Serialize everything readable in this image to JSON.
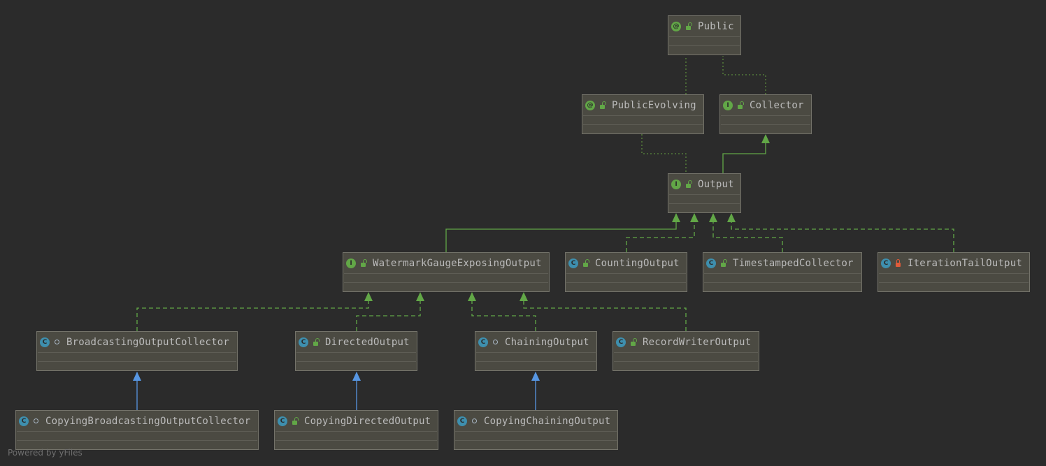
{
  "colors": {
    "background": "#2b2b2b",
    "node_fill": "#4b4a42",
    "interface_edge": "#62a747",
    "class_extends_edge": "#5796e2",
    "annotation_edge": "#62a747"
  },
  "nodes": [
    {
      "id": "Public",
      "label": "Public",
      "kind": "annotation",
      "kind_icon": "annotation-icon",
      "visibility": "public"
    },
    {
      "id": "PublicEvolving",
      "label": "PublicEvolving",
      "kind": "annotation",
      "kind_icon": "annotation-icon",
      "visibility": "public"
    },
    {
      "id": "Collector",
      "label": "Collector",
      "kind": "interface",
      "kind_icon": "interface-icon",
      "visibility": "public"
    },
    {
      "id": "Output",
      "label": "Output",
      "kind": "interface",
      "kind_icon": "interface-icon",
      "visibility": "public"
    },
    {
      "id": "WatermarkGaugeExposingOutput",
      "label": "WatermarkGaugeExposingOutput",
      "kind": "interface",
      "kind_icon": "interface-icon",
      "visibility": "public"
    },
    {
      "id": "CountingOutput",
      "label": "CountingOutput",
      "kind": "class",
      "kind_icon": "class-icon",
      "visibility": "public"
    },
    {
      "id": "TimestampedCollector",
      "label": "TimestampedCollector",
      "kind": "class",
      "kind_icon": "class-icon",
      "visibility": "public"
    },
    {
      "id": "IterationTailOutput",
      "label": "IterationTailOutput",
      "kind": "class",
      "kind_icon": "class-icon",
      "visibility": "private"
    },
    {
      "id": "BroadcastingOutputCollector",
      "label": "BroadcastingOutputCollector",
      "kind": "class",
      "kind_icon": "class-icon",
      "visibility": "package"
    },
    {
      "id": "DirectedOutput",
      "label": "DirectedOutput",
      "kind": "class",
      "kind_icon": "class-icon",
      "visibility": "public"
    },
    {
      "id": "ChainingOutput",
      "label": "ChainingOutput",
      "kind": "class",
      "kind_icon": "class-icon",
      "visibility": "package"
    },
    {
      "id": "RecordWriterOutput",
      "label": "RecordWriterOutput",
      "kind": "class",
      "kind_icon": "class-icon",
      "visibility": "public"
    },
    {
      "id": "CopyingBroadcastingOutputCollector",
      "label": "CopyingBroadcastingOutputCollector",
      "kind": "class",
      "kind_icon": "class-icon",
      "visibility": "package"
    },
    {
      "id": "CopyingDirectedOutput",
      "label": "CopyingDirectedOutput",
      "kind": "class",
      "kind_icon": "class-icon",
      "visibility": "public"
    },
    {
      "id": "CopyingChainingOutput",
      "label": "CopyingChainingOutput",
      "kind": "class",
      "kind_icon": "class-icon",
      "visibility": "package"
    }
  ],
  "edges": [
    {
      "from": "PublicEvolving",
      "to": "Public",
      "type": "annotated-by"
    },
    {
      "from": "Collector",
      "to": "Public",
      "type": "annotated-by"
    },
    {
      "from": "Output",
      "to": "PublicEvolving",
      "type": "annotated-by"
    },
    {
      "from": "Output",
      "to": "Collector",
      "type": "extends-interface"
    },
    {
      "from": "WatermarkGaugeExposingOutput",
      "to": "Output",
      "type": "extends-interface"
    },
    {
      "from": "CountingOutput",
      "to": "Output",
      "type": "implements"
    },
    {
      "from": "TimestampedCollector",
      "to": "Output",
      "type": "implements"
    },
    {
      "from": "IterationTailOutput",
      "to": "Output",
      "type": "implements"
    },
    {
      "from": "BroadcastingOutputCollector",
      "to": "WatermarkGaugeExposingOutput",
      "type": "implements"
    },
    {
      "from": "DirectedOutput",
      "to": "WatermarkGaugeExposingOutput",
      "type": "implements"
    },
    {
      "from": "ChainingOutput",
      "to": "WatermarkGaugeExposingOutput",
      "type": "implements"
    },
    {
      "from": "RecordWriterOutput",
      "to": "WatermarkGaugeExposingOutput",
      "type": "implements"
    },
    {
      "from": "CopyingBroadcastingOutputCollector",
      "to": "BroadcastingOutputCollector",
      "type": "extends"
    },
    {
      "from": "CopyingDirectedOutput",
      "to": "DirectedOutput",
      "type": "extends"
    },
    {
      "from": "CopyingChainingOutput",
      "to": "ChainingOutput",
      "type": "extends"
    }
  ],
  "footer": "Powered by yFiles"
}
